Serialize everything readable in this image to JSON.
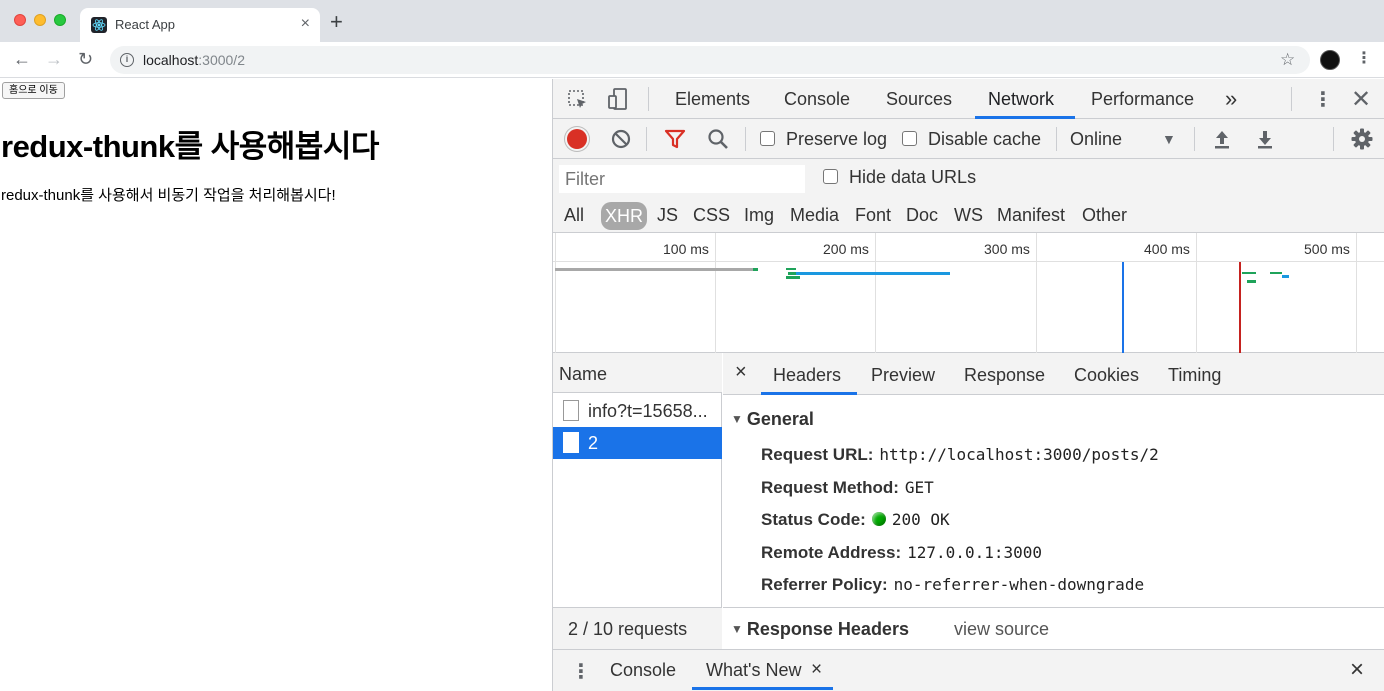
{
  "browser": {
    "tab_title": "React App",
    "tab_close": "×",
    "new_tab": "+",
    "url_host": "localhost",
    "url_path": ":3000/2"
  },
  "page": {
    "home_button": "홈으로 이동",
    "heading": "redux-thunk를 사용해봅시다",
    "body": "redux-thunk를 사용해서 비동기 작업을 처리해봅시다!"
  },
  "devtools": {
    "tabs": [
      "Elements",
      "Console",
      "Sources",
      "Network",
      "Performance"
    ],
    "active_tab": "Network",
    "more_tabs": "»",
    "toolbar": {
      "preserve_log": "Preserve log",
      "disable_cache": "Disable cache",
      "throttling": "Online"
    },
    "filter": {
      "placeholder": "Filter",
      "hide_data_urls": "Hide data URLs",
      "types": [
        "All",
        "XHR",
        "JS",
        "CSS",
        "Img",
        "Media",
        "Font",
        "Doc",
        "WS",
        "Manifest",
        "Other"
      ],
      "active_type": "XHR"
    },
    "overview": {
      "ticks": [
        "100 ms",
        "200 ms",
        "300 ms",
        "400 ms",
        "500 ms"
      ]
    },
    "requests": {
      "header": "Name",
      "rows": [
        {
          "name": "info?t=15658..."
        },
        {
          "name": "2"
        }
      ],
      "selected": "2",
      "status": "2 / 10 requests"
    },
    "detail": {
      "close": "×",
      "tabs": [
        "Headers",
        "Preview",
        "Response",
        "Cookies",
        "Timing"
      ],
      "active_tab": "Headers",
      "general_title": "General",
      "general": [
        {
          "key": "Request URL:",
          "value": "http://localhost:3000/posts/2"
        },
        {
          "key": "Request Method:",
          "value": "GET"
        },
        {
          "key": "Status Code:",
          "value": "200 OK"
        },
        {
          "key": "Remote Address:",
          "value": "127.0.0.1:3000"
        },
        {
          "key": "Referrer Policy:",
          "value": "no-referrer-when-downgrade"
        }
      ],
      "response_headers_title": "Response Headers",
      "view_source": "view source"
    },
    "drawer": {
      "tabs": [
        "Console",
        "What's New"
      ],
      "active_tab": "What's New",
      "tab_close": "×",
      "close": "×"
    }
  },
  "colors": {
    "accent": "#1a73e8",
    "record": "#d93025",
    "status_ok": "#00aa00"
  }
}
